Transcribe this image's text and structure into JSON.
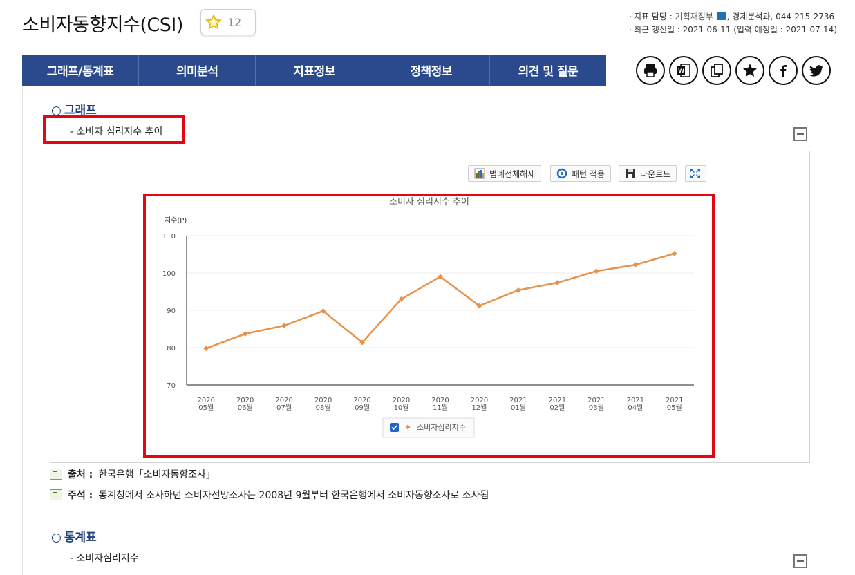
{
  "header": {
    "title": "소비자동향지수(CSI)",
    "favorite_count": "12",
    "meta_line1_prefix": "지표 담당 : ",
    "meta_line1_org": "기획재정부",
    "meta_line1_rest": ", 경제분석과, 044-215-2736",
    "meta_line2": "최근 갱신일 : 2021-06-11 (입력 예정일 : 2021-07-14)"
  },
  "nav": {
    "tabs": [
      "그래프/통계표",
      "의미분석",
      "지표정보",
      "정책정보",
      "의견 및 질문"
    ]
  },
  "share_icons": [
    "print-icon",
    "word-icon",
    "copy-icon",
    "star-icon",
    "facebook-icon",
    "twitter-icon"
  ],
  "section_graph": {
    "title": "그래프",
    "subtitle": "- 소비자 심리지수 추이"
  },
  "toolbar": {
    "legend_off": "범례전체해제",
    "pattern": "패턴 적용",
    "download": "다운로드"
  },
  "chart_data": {
    "type": "line",
    "title": "소비자 심리지수 추이",
    "ylabel": "지수(P)",
    "ylim": [
      70,
      110
    ],
    "yticks": [
      70,
      80,
      90,
      100,
      110
    ],
    "categories": [
      [
        "2020",
        "05월"
      ],
      [
        "2020",
        "06월"
      ],
      [
        "2020",
        "07월"
      ],
      [
        "2020",
        "08월"
      ],
      [
        "2020",
        "09월"
      ],
      [
        "2020",
        "10월"
      ],
      [
        "2020",
        "11월"
      ],
      [
        "2020",
        "12월"
      ],
      [
        "2021",
        "01월"
      ],
      [
        "2021",
        "02월"
      ],
      [
        "2021",
        "03월"
      ],
      [
        "2021",
        "04월"
      ],
      [
        "2021",
        "05월"
      ]
    ],
    "series": [
      {
        "name": "소비자심리지수",
        "color": "#e8914a",
        "values": [
          79.8,
          83.7,
          85.9,
          89.8,
          81.4,
          93.0,
          99.0,
          91.2,
          95.4,
          97.4,
          100.5,
          102.2,
          105.2
        ]
      }
    ],
    "legend_position": "bottom",
    "grid": true
  },
  "notes": {
    "source_label": "출처 :",
    "source_text": "한국은행「소비자동향조사」",
    "comment_label": "주석 :",
    "comment_text": "통계청에서 조사하던 소비자전망조사는 2008년 9월부터 한국은행에서 소비자동향조사로 조사됨"
  },
  "section_table": {
    "title": "통계표",
    "subtitle": "- 소비자심리지수"
  }
}
